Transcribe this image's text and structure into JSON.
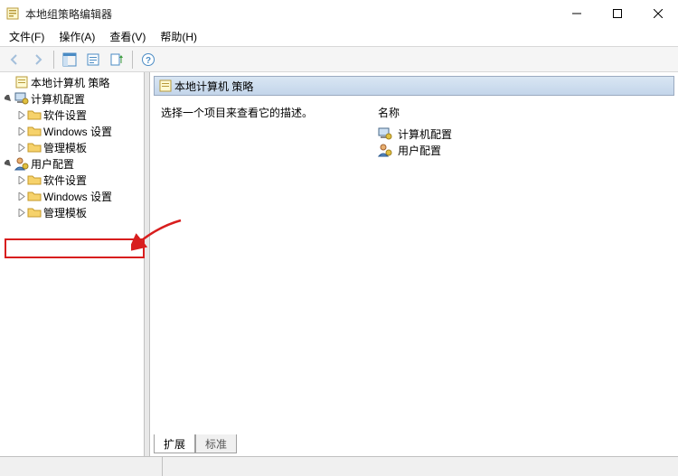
{
  "window": {
    "title": "本地组策略编辑器"
  },
  "menubar": {
    "file": "文件(F)",
    "action": "操作(A)",
    "view": "查看(V)",
    "help": "帮助(H)"
  },
  "tree": {
    "root": "本地计算机 策略",
    "computer_cfg": "计算机配置",
    "user_cfg": "用户配置",
    "software": "软件设置",
    "windows": "Windows 设置",
    "templates": "管理模板"
  },
  "right": {
    "header": "本地计算机 策略",
    "desc": "选择一个项目来查看它的描述。",
    "column_name": "名称",
    "items": {
      "computer_cfg": "计算机配置",
      "user_cfg": "用户配置"
    }
  },
  "tabs": {
    "extended": "扩展",
    "standard": "标准"
  }
}
